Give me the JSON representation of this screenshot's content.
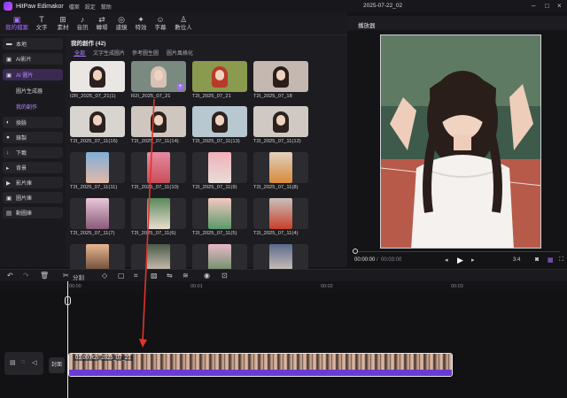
{
  "titlebar": {
    "app_name": "HitPaw Edimakor",
    "menu": [
      "檔案",
      "設定",
      "幫助"
    ],
    "doc_title": "2025-07-22_02"
  },
  "toolbar": {
    "tools": [
      {
        "label": "我的檔案",
        "icon": "folder-icon",
        "active": true
      },
      {
        "label": "文字",
        "icon": "text-icon",
        "active": false
      },
      {
        "label": "素材",
        "icon": "grid-icon",
        "active": false
      },
      {
        "label": "音訊",
        "icon": "music-icon",
        "active": false
      },
      {
        "label": "轉場",
        "icon": "transition-icon",
        "active": false
      },
      {
        "label": "濾鏡",
        "icon": "filter-icon",
        "active": false
      },
      {
        "label": "特效",
        "icon": "effect-icon",
        "active": false
      },
      {
        "label": "字幕",
        "icon": "subtitle-icon",
        "active": false
      },
      {
        "label": "數位人",
        "icon": "avatar-icon",
        "active": false
      }
    ]
  },
  "sidebar": {
    "items": [
      {
        "label": "本地",
        "icon": "folder-icon"
      },
      {
        "label": "AI影片",
        "icon": "ai-video-icon"
      },
      {
        "label": "AI 圖片",
        "icon": "ai-image-icon",
        "active": true
      },
      {
        "label": "換臉",
        "icon": "face-swap-icon"
      },
      {
        "label": "錄製",
        "icon": "record-icon"
      },
      {
        "label": "下載",
        "icon": "download-icon"
      },
      {
        "label": "背景",
        "icon": "background-icon"
      },
      {
        "label": "影片庫",
        "icon": "video-library-icon"
      },
      {
        "label": "圖片庫",
        "icon": "image-library-icon"
      },
      {
        "label": "動圖庫",
        "icon": "gif-library-icon"
      }
    ],
    "subitems": [
      {
        "label": "圖片生成器"
      },
      {
        "label": "我的創作",
        "active": true
      }
    ]
  },
  "gallery": {
    "title": "我的創作 (42)",
    "tabs": [
      "全部",
      "文字生成圖片",
      "參考圖生圖",
      "圖片風格化"
    ],
    "items": [
      "I2R_2025_07_21(1)",
      "R2I_2025_07_21",
      "T2I_2025_07_21",
      "T2I_2025_07_18",
      "T2I_2025_07_11(15)",
      "T2I_2025_07_11(14)",
      "T2I_2025_07_11(13)",
      "T2I_2025_07_11(12)",
      "T2I_2025_07_11(11)",
      "T2I_2025_07_11(10)",
      "T2I_2025_07_11(9)",
      "T2I_2025_07_11(8)",
      "T2I_2025_07_11(7)",
      "T2I_2025_07_11(6)",
      "T2I_2025_07_11(5)",
      "T2I_2025_07_11(4)",
      "",
      "",
      "",
      ""
    ]
  },
  "player": {
    "title": "播放器",
    "current_time": "00:00:00",
    "total_time": "00:03:00",
    "aspect": "3:4"
  },
  "timeline": {
    "split_label": "分割",
    "ruler": [
      "00:00",
      "00:01",
      "00:02",
      "00:03"
    ],
    "cover_label": "封面",
    "clip_label": "03.00 R2I_2025_07_21"
  },
  "colors": {
    "accent": "#a86cff",
    "annotation_arrow": "#e0342c",
    "audio_track": "#6b3ad6"
  }
}
